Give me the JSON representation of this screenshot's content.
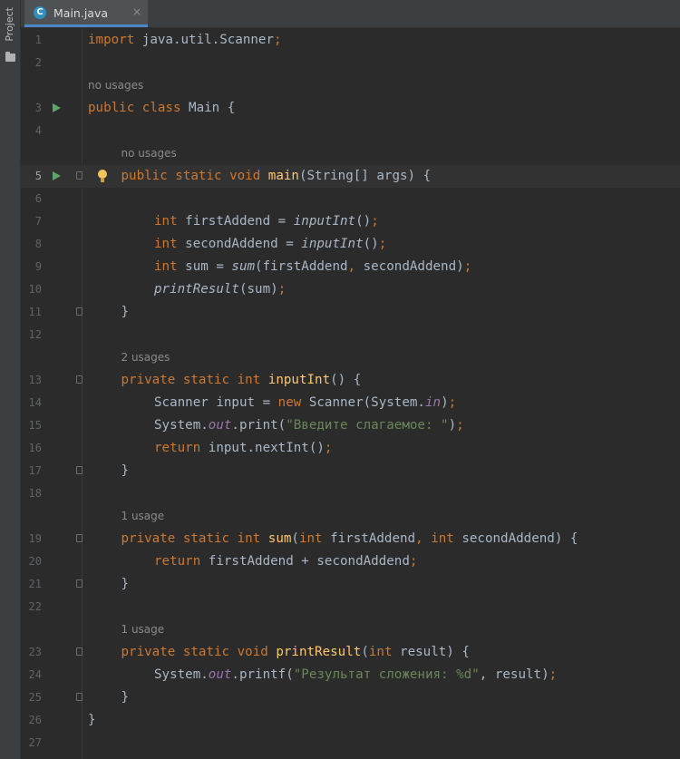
{
  "sidebar": {
    "project_label": "Project",
    "folder_icon": "folder-icon"
  },
  "tab": {
    "label": "Main.java",
    "close": "×",
    "icon": "java-class-icon",
    "icon_letter": "C"
  },
  "colors": {
    "background": "#2b2b2b",
    "keyword": "#cc7832",
    "method_declaration": "#ffc66d",
    "string": "#6a8759",
    "static_field": "#9876aa",
    "text": "#a9b7c6",
    "run_icon": "#59a869"
  },
  "editor": {
    "current_line": 5,
    "lines": [
      {
        "n": "1",
        "tokens": [
          {
            "t": "import",
            "c": "kw"
          },
          {
            "t": " java.util.Scanner"
          },
          {
            "t": ";",
            "c": "kw"
          }
        ]
      },
      {
        "n": "2",
        "tokens": []
      },
      {
        "hint": "no usages"
      },
      {
        "n": "3",
        "run": true,
        "tokens": [
          {
            "t": "public class",
            "c": "kw"
          },
          {
            "t": " Main {"
          }
        ]
      },
      {
        "n": "4",
        "tokens": []
      },
      {
        "hint": "no usages",
        "indent": 1
      },
      {
        "n": "5",
        "run": true,
        "fold": true,
        "bulb": true,
        "indent": 1,
        "tokens": [
          {
            "t": "public static void",
            "c": "kw"
          },
          {
            "t": " "
          },
          {
            "t": "main",
            "c": "fn"
          },
          {
            "t": "(String[] args) {"
          }
        ]
      },
      {
        "n": "6",
        "tokens": []
      },
      {
        "n": "7",
        "indent": 2,
        "tokens": [
          {
            "t": "int",
            "c": "kw"
          },
          {
            "t": " firstAddend = "
          },
          {
            "t": "inputInt",
            "c": "it"
          },
          {
            "t": "()"
          },
          {
            "t": ";",
            "c": "kw"
          }
        ]
      },
      {
        "n": "8",
        "indent": 2,
        "tokens": [
          {
            "t": "int",
            "c": "kw"
          },
          {
            "t": " secondAddend = "
          },
          {
            "t": "inputInt",
            "c": "it"
          },
          {
            "t": "()"
          },
          {
            "t": ";",
            "c": "kw"
          }
        ]
      },
      {
        "n": "9",
        "indent": 2,
        "tokens": [
          {
            "t": "int",
            "c": "kw"
          },
          {
            "t": " sum = "
          },
          {
            "t": "sum",
            "c": "it"
          },
          {
            "t": "(firstAddend"
          },
          {
            "t": ",",
            "c": "kw"
          },
          {
            "t": " secondAddend)"
          },
          {
            "t": ";",
            "c": "kw"
          }
        ]
      },
      {
        "n": "10",
        "indent": 2,
        "tokens": [
          {
            "t": "printResult",
            "c": "it"
          },
          {
            "t": "(sum)"
          },
          {
            "t": ";",
            "c": "kw"
          }
        ]
      },
      {
        "n": "11",
        "fold": true,
        "indent": 1,
        "tokens": [
          {
            "t": "}"
          }
        ]
      },
      {
        "n": "12",
        "tokens": []
      },
      {
        "hint": "2 usages",
        "indent": 1
      },
      {
        "n": "13",
        "fold": true,
        "indent": 1,
        "tokens": [
          {
            "t": "private static int",
            "c": "kw"
          },
          {
            "t": " "
          },
          {
            "t": "inputInt",
            "c": "fn"
          },
          {
            "t": "() {"
          }
        ]
      },
      {
        "n": "14",
        "indent": 2,
        "tokens": [
          {
            "t": "Scanner input = "
          },
          {
            "t": "new",
            "c": "kw"
          },
          {
            "t": " Scanner(System."
          },
          {
            "t": "in",
            "c": "sf"
          },
          {
            "t": ")"
          },
          {
            "t": ";",
            "c": "kw"
          }
        ]
      },
      {
        "n": "15",
        "indent": 2,
        "tokens": [
          {
            "t": "System."
          },
          {
            "t": "out",
            "c": "sf"
          },
          {
            "t": ".print("
          },
          {
            "t": "\"Введите слагаемое: \"",
            "c": "st"
          },
          {
            "t": ")"
          },
          {
            "t": ";",
            "c": "kw"
          }
        ]
      },
      {
        "n": "16",
        "indent": 2,
        "tokens": [
          {
            "t": "return",
            "c": "kw"
          },
          {
            "t": " input.nextInt()"
          },
          {
            "t": ";",
            "c": "kw"
          }
        ]
      },
      {
        "n": "17",
        "fold": true,
        "indent": 1,
        "tokens": [
          {
            "t": "}"
          }
        ]
      },
      {
        "n": "18",
        "tokens": []
      },
      {
        "hint": "1 usage",
        "indent": 1
      },
      {
        "n": "19",
        "fold": true,
        "indent": 1,
        "tokens": [
          {
            "t": "private static int",
            "c": "kw"
          },
          {
            "t": " "
          },
          {
            "t": "sum",
            "c": "fn"
          },
          {
            "t": "("
          },
          {
            "t": "int",
            "c": "kw"
          },
          {
            "t": " firstAddend"
          },
          {
            "t": ",",
            "c": "kw"
          },
          {
            "t": " "
          },
          {
            "t": "int",
            "c": "kw"
          },
          {
            "t": " secondAddend) {"
          }
        ]
      },
      {
        "n": "20",
        "indent": 2,
        "tokens": [
          {
            "t": "return",
            "c": "kw"
          },
          {
            "t": " firstAddend + secondAddend"
          },
          {
            "t": ";",
            "c": "kw"
          }
        ]
      },
      {
        "n": "21",
        "fold": true,
        "indent": 1,
        "tokens": [
          {
            "t": "}"
          }
        ]
      },
      {
        "n": "22",
        "tokens": []
      },
      {
        "hint": "1 usage",
        "indent": 1
      },
      {
        "n": "23",
        "fold": true,
        "indent": 1,
        "tokens": [
          {
            "t": "private static void",
            "c": "kw"
          },
          {
            "t": " "
          },
          {
            "t": "printResult",
            "c": "fn"
          },
          {
            "t": "("
          },
          {
            "t": "int",
            "c": "kw"
          },
          {
            "t": " result) {"
          }
        ]
      },
      {
        "n": "24",
        "indent": 2,
        "tokens": [
          {
            "t": "System."
          },
          {
            "t": "out",
            "c": "sf"
          },
          {
            "t": ".printf("
          },
          {
            "t": "\"Результат сложения: %d\"",
            "c": "st"
          },
          {
            "t": ","
          },
          {
            "t": " result)"
          },
          {
            "t": ";",
            "c": "kw"
          }
        ]
      },
      {
        "n": "25",
        "fold": true,
        "indent": 1,
        "tokens": [
          {
            "t": "}"
          }
        ]
      },
      {
        "n": "26",
        "tokens": [
          {
            "t": "}"
          }
        ]
      },
      {
        "n": "27",
        "tokens": []
      }
    ]
  }
}
